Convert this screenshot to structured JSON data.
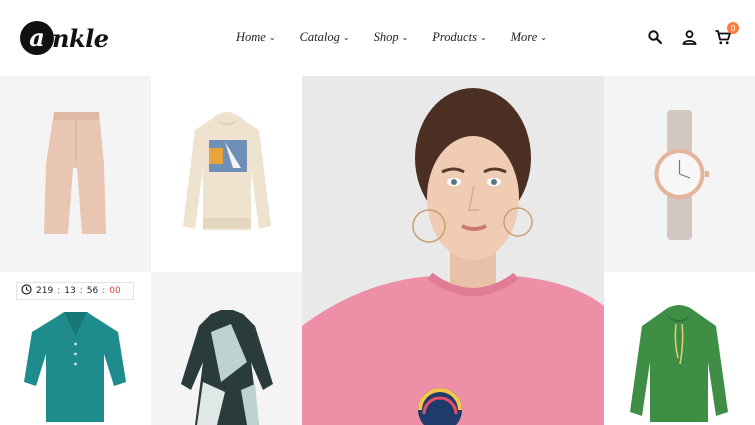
{
  "brand": {
    "logo_letter": "a",
    "logo_rest": "nkle"
  },
  "nav": [
    {
      "label": "Home"
    },
    {
      "label": "Catalog"
    },
    {
      "label": "Shop"
    },
    {
      "label": "Products"
    },
    {
      "label": "More"
    }
  ],
  "cart": {
    "count": "0"
  },
  "icons": [
    "search-icon",
    "user-icon",
    "cart-icon"
  ],
  "countdown": {
    "days": "219",
    "hours": "13",
    "minutes": "56",
    "seconds": "00"
  },
  "colors": {
    "accent": "#ff7a3d",
    "countdown_seconds": "#e23b3b"
  }
}
